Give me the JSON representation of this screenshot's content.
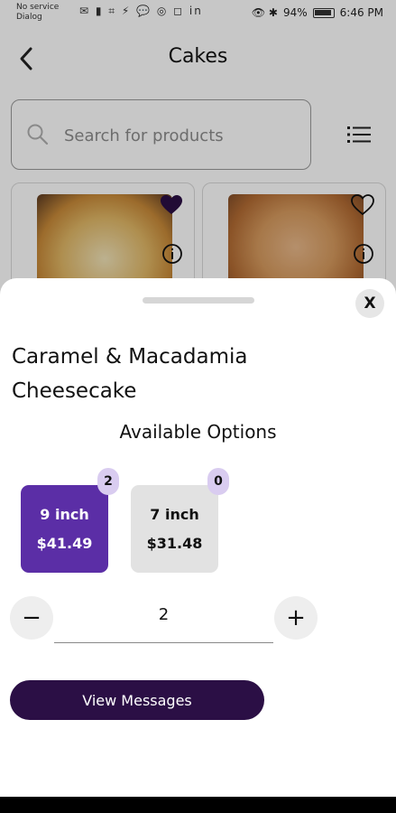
{
  "status_bar": {
    "carrier_line_1": "No service",
    "carrier_line_2": "Dialog",
    "left_icons": "✉ ▮ ⌗ ⚡ 💬 ◎ ◻ in",
    "right_icons": "👁 ✱",
    "battery": "94%",
    "time": "6:46 PM"
  },
  "header": {
    "back_icon": "chevron-left-icon",
    "title": "Cakes"
  },
  "search": {
    "placeholder": "Search for products",
    "value": ""
  },
  "products": [
    {
      "image": "cake-vanilla-meringue",
      "favorited": true
    },
    {
      "image": "cake-caramel-decorated",
      "favorited": false
    }
  ],
  "sheet": {
    "product_title": "Caramel & Macadamia Cheesecake",
    "options_heading": "Available Options",
    "options": [
      {
        "size": "9 inch",
        "price": "$41.49",
        "count": "2",
        "selected": true
      },
      {
        "size": "7 inch",
        "price": "$31.48",
        "count": "0",
        "selected": false
      }
    ],
    "quantity": "2",
    "minus_label": "−",
    "plus_label": "+",
    "close_label": "X",
    "view_messages_label": "View Messages"
  },
  "colors": {
    "selected_option": "#5b2ea6",
    "unselected_option": "#e2e2e2",
    "badge": "#d9ccf0",
    "primary_button": "#2b0f45"
  }
}
